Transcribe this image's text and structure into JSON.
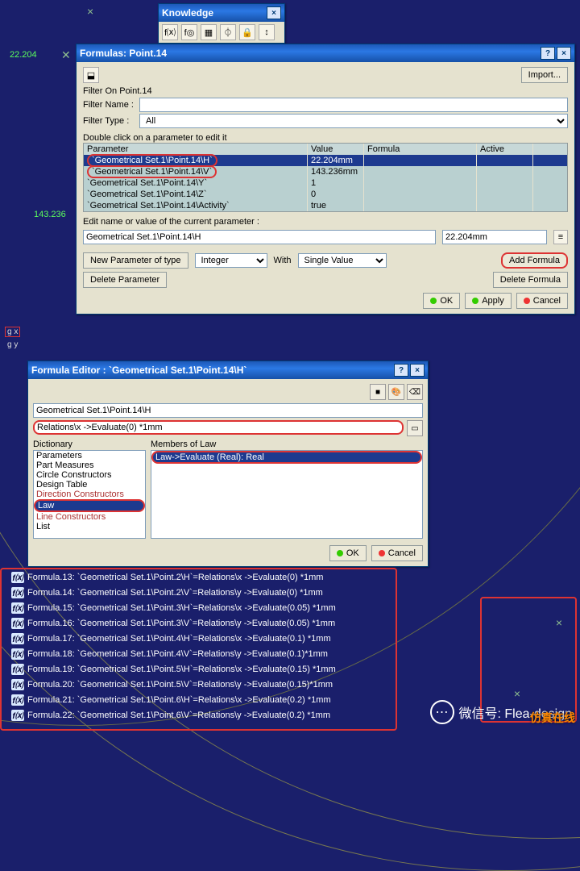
{
  "cad": {
    "dim1": "22.204",
    "dim2": "143.236",
    "axis_gx": "g x",
    "axis_gy": "g y"
  },
  "knowledge": {
    "title": "Knowledge"
  },
  "formulas": {
    "title": "Formulas: Point.14",
    "import": "Import...",
    "filter_on_label": "Filter On Point.14",
    "filter_name_label": "Filter Name :",
    "filter_name_value": "",
    "filter_type_label": "Filter Type :",
    "filter_type_value": "All",
    "dbl_click": "Double click on a parameter to edit it",
    "columns": {
      "param": "Parameter",
      "value": "Value",
      "formula": "Formula",
      "active": "Active"
    },
    "rows": [
      {
        "param": "`Geometrical Set.1\\Point.14\\H`",
        "value": "22.204mm"
      },
      {
        "param": "`Geometrical Set.1\\Point.14\\V`",
        "value": "143.236mm"
      },
      {
        "param": "`Geometrical Set.1\\Point.14\\Y`",
        "value": "1"
      },
      {
        "param": "`Geometrical Set.1\\Point.14\\Z`",
        "value": "0"
      },
      {
        "param": "`Geometrical Set.1\\Point.14\\Activity`",
        "value": "true"
      }
    ],
    "edit_label": "Edit name or value of the current parameter :",
    "edit_name": "Geometrical Set.1\\Point.14\\H",
    "edit_value": "22.204mm",
    "new_param": "New Parameter of type",
    "type_val": "Integer",
    "with": "With",
    "with_val": "Single Value",
    "add_formula": "Add Formula",
    "delete_param": "Delete Parameter",
    "delete_formula": "Delete Formula",
    "ok": "OK",
    "apply": "Apply",
    "cancel": "Cancel"
  },
  "feditor": {
    "title": "Formula Editor : `Geometrical Set.1\\Point.14\\H`",
    "path": "Geometrical Set.1\\Point.14\\H",
    "expr": "Relations\\x ->Evaluate(0) *1mm",
    "dict_label": "Dictionary",
    "members_label": "Members of Law",
    "dict": [
      "Parameters",
      "Part Measures",
      "Circle Constructors",
      "Design Table",
      "Direction Constructors",
      "Law",
      "Line Constructors",
      "List"
    ],
    "members": [
      "Law->Evaluate (Real): Real"
    ],
    "ok": "OK",
    "cancel": "Cancel"
  },
  "tree": [
    {
      "name": "Formula.13:",
      "expr": "`Geometrical Set.1\\Point.2\\H`=Relations\\x ->Evaluate(0) *1mm"
    },
    {
      "name": "Formula.14:",
      "expr": "`Geometrical Set.1\\Point.2\\V`=Relations\\y ->Evaluate(0) *1mm"
    },
    {
      "name": "Formula.15:",
      "expr": "`Geometrical Set.1\\Point.3\\H`=Relations\\x ->Evaluate(0.05) *1mm"
    },
    {
      "name": "Formula.16:",
      "expr": "`Geometrical Set.1\\Point.3\\V`=Relations\\y ->Evaluate(0.05) *1mm"
    },
    {
      "name": "Formula.17:",
      "expr": "`Geometrical Set.1\\Point.4\\H`=Relations\\x ->Evaluate(0.1) *1mm"
    },
    {
      "name": "Formula.18:",
      "expr": "`Geometrical Set.1\\Point.4\\V`=Relations\\y ->Evaluate(0.1)*1mm"
    },
    {
      "name": "Formula.19:",
      "expr": "`Geometrical Set.1\\Point.5\\H`=Relations\\x ->Evaluate(0.15) *1mm"
    },
    {
      "name": "Formula.20:",
      "expr": "`Geometrical Set.1\\Point.5\\V`=Relations\\y ->Evaluate(0.15)*1mm"
    },
    {
      "name": "Formula.21:",
      "expr": "`Geometrical Set.1\\Point.6\\H`=Relations\\x ->Evaluate(0.2) *1mm"
    },
    {
      "name": "Formula.22:",
      "expr": "`Geometrical Set.1\\Point.6\\V`=Relations\\y ->Evaluate(0.2) *1mm"
    }
  ],
  "wechat": {
    "label": "微信号: Flea-design"
  },
  "watermark": "仿真在线"
}
